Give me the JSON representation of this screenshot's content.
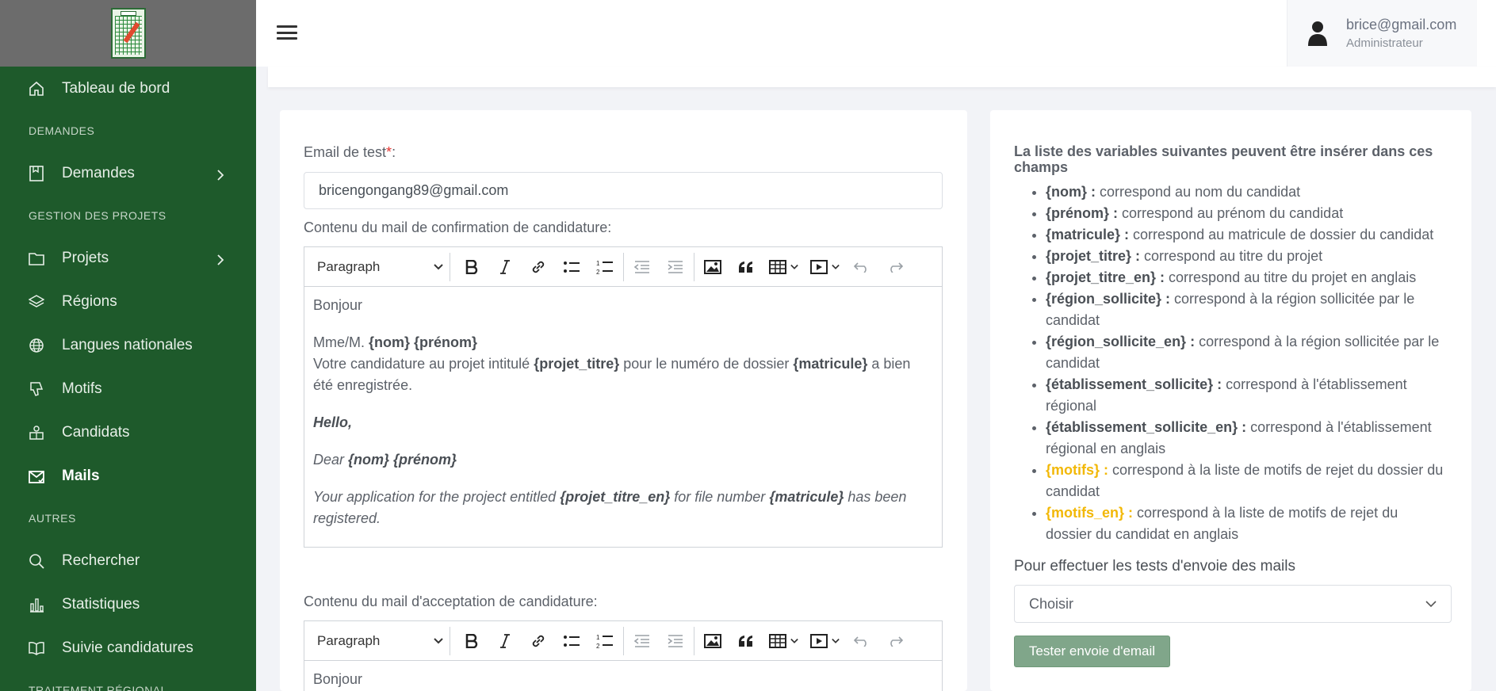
{
  "sidebar": {
    "items": [
      {
        "type": "item",
        "label": "Tableau de bord",
        "icon": "home-icon"
      },
      {
        "type": "heading",
        "label": "DEMANDES"
      },
      {
        "type": "item",
        "label": "Demandes",
        "icon": "book-icon",
        "chevron": true
      },
      {
        "type": "heading",
        "label": "GESTION DES PROJETS"
      },
      {
        "type": "item",
        "label": "Projets",
        "icon": "folder-icon",
        "chevron": true
      },
      {
        "type": "item",
        "label": "Régions",
        "icon": "layers-icon"
      },
      {
        "type": "item",
        "label": "Langues nationales",
        "icon": "globe-icon"
      },
      {
        "type": "item",
        "label": "Motifs",
        "icon": "thumbs-down-icon"
      },
      {
        "type": "item",
        "label": "Candidats",
        "icon": "user-group-icon"
      },
      {
        "type": "item",
        "label": "Mails",
        "icon": "mail-icon",
        "active": true
      },
      {
        "type": "heading",
        "label": "AUTRES"
      },
      {
        "type": "item",
        "label": "Rechercher",
        "icon": "search-icon"
      },
      {
        "type": "item",
        "label": "Statistiques",
        "icon": "bar-chart-icon"
      },
      {
        "type": "item",
        "label": "Suivie candidatures",
        "icon": "open-book-icon"
      },
      {
        "type": "heading",
        "label": "TRAITEMENT RÉGIONAL"
      }
    ]
  },
  "header": {
    "user_email": "brice@gmail.com",
    "user_role": "Administrateur"
  },
  "form": {
    "email_label": "Email de test",
    "email_required_mark": "*",
    "email_suffix": ":",
    "email_value": "bricengongang89@gmail.com",
    "confirm_label": "Contenu du mail de confirmation de candidature:",
    "accept_label": "Contenu du mail d'acceptation de candidature:",
    "toolbar_format": "Paragraph",
    "editor1": {
      "p1": "Bonjour",
      "p2_prefix": "Mme/M. ",
      "p2_vars": "{nom} {prénom}",
      "p3_a": "Votre candidature au projet intitulé ",
      "p3_var1": "{projet_titre}",
      "p3_b": " pour le numéro de dossier ",
      "p3_var2": "{matricule}",
      "p3_c": " a bien été enregistrée.",
      "p4": "Hello,",
      "p5_prefix": "Dear ",
      "p5_vars": "{nom} {prénom}",
      "p6_a": "Your application for the project entitled ",
      "p6_var1": "{projet_titre_en}",
      "p6_b": " for file number ",
      "p6_var2": "{matricule}",
      "p6_c": " has been registered."
    },
    "editor2": {
      "p1": "Bonjour"
    }
  },
  "variables": {
    "title": "La liste des variables suivantes peuvent être insérer dans ces champs",
    "items": [
      {
        "key": "{nom} :",
        "desc": " correspond au nom du candidat"
      },
      {
        "key": "{prénom} :",
        "desc": " correspond au prénom du candidat"
      },
      {
        "key": "{matricule} :",
        "desc": " correspond au matricule de dossier du candidat"
      },
      {
        "key": "{projet_titre} :",
        "desc": " correspond au titre du projet"
      },
      {
        "key": "{projet_titre_en} :",
        "desc": " correspond au titre du projet en anglais"
      },
      {
        "key": "{région_sollicite} :",
        "desc": " correspond à la région sollicitée par le candidat"
      },
      {
        "key": "{région_sollicite_en} :",
        "desc": " correspond à la région sollicitée par le candidat"
      },
      {
        "key": "{établissement_sollicite} :",
        "desc": " correspond à l'établissement régional"
      },
      {
        "key": "{établissement_sollicite_en} :",
        "desc": " correspond à l'établissement régional en anglais"
      },
      {
        "key": "{motifs} :",
        "desc": " correspond à la liste de motifs de rejet du dossier du candidat",
        "highlight": true
      },
      {
        "key": "{motifs_en} :",
        "desc": " correspond à la liste de motifs de rejet du dossier du candidat en anglais",
        "highlight": true
      }
    ],
    "test_title": "Pour effectuer les tests d'envoie des mails",
    "select_value": "Choisir",
    "button_label": "Tester envoie d'email"
  },
  "colors": {
    "sidebar_bg": "#1e5a2b",
    "highlight": "#f2b807",
    "button": "#80a68a"
  }
}
